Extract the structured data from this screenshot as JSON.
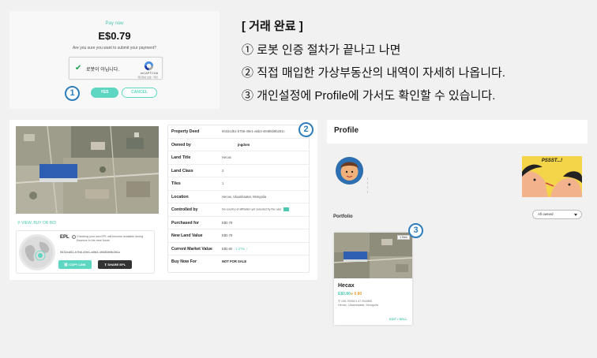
{
  "payment": {
    "label": "Pay now",
    "amount": "E$0.79",
    "question": "Are you sure you want to submit your payment?",
    "captcha_text": "로봇이 아닙니다.",
    "captcha_brand": "reCAPTCHA",
    "captcha_links": "개인정보 보호 - 약관",
    "yes_label": "YES",
    "cancel_label": "CANCEL",
    "step_badge": "1"
  },
  "instructions": {
    "title": "[ 거래 완료 ]",
    "steps": [
      "① 로봇 인증 절차가 끝나고 나면",
      "② 직접 매입한 가상부동산의 내역이 자세히 나옵니다.",
      "③ 개인설정에 Profile에 가서도 확인할 수 있습니다."
    ]
  },
  "property": {
    "step_badge": "2",
    "view_link": "VIEW, BUY OR BID",
    "epl": {
      "title": "EPL",
      "note": "Checking your own EPL will become available during Essence in the near future",
      "hash": "9432cd51-b7b6-49e1-a5b3-49485b9b281c",
      "copy_label": "COPY LINK",
      "share_label": "SHARE EPL"
    },
    "rows": [
      {
        "label": "Property Deed",
        "value": "9432cd51-b7b6-49e1-a5b3-49485b9b281c"
      },
      {
        "label": "Owned by",
        "value": "jngdom"
      },
      {
        "label": "Land Title",
        "value": "Hecax"
      },
      {
        "label": "Land Class",
        "value": "2"
      },
      {
        "label": "Tiles",
        "value": "1"
      },
      {
        "label": "Location",
        "value": "Hecax, Ulaanbaatar, Mongolia"
      },
      {
        "label": "Controlled by",
        "value": "No country of affiliation yet selected by the user"
      },
      {
        "label": "Purchased for",
        "value": "E$0.79"
      },
      {
        "label": "New Land Value",
        "value": "E$0.79"
      },
      {
        "label": "Current Market Value",
        "value": "E$0.80",
        "change": "1.27% ↑"
      },
      {
        "label": "Buy Now For",
        "value": "NOT FOR SALE"
      }
    ]
  },
  "profile": {
    "title": "Profile",
    "portfolio_label": "Portfolio",
    "filter": "All owned",
    "comic_text": "PSSST...!",
    "card": {
      "step_badge": "3",
      "tiles": "1 tiles",
      "name": "Hecax",
      "price": "E$0.80",
      "price_alt": "0.80",
      "coords": "106.759613 47.954865",
      "place": "Hecax, Ulaanbaatar, Mongolia",
      "action": "EDIT / SELL"
    }
  },
  "colors": {
    "accent": "#5dd7c2",
    "badge": "#2d7dbb",
    "dark_button": "#333333"
  }
}
